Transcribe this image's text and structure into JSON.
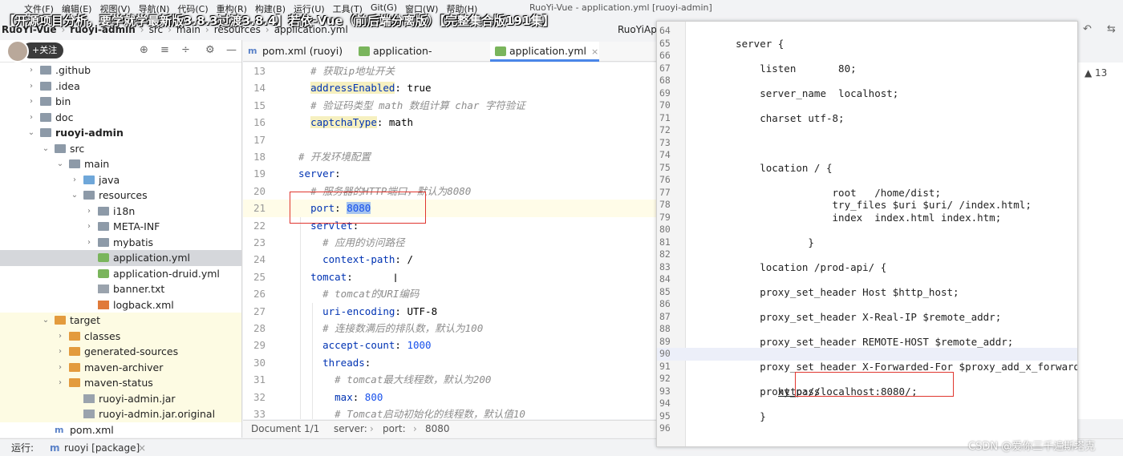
{
  "overlay_title": "【开源项目分析，要学就学最新版3.8.3过渡3.8.4】若依-Vue（前后端分离版）【完整集合版191集】",
  "menubar": {
    "items": [
      "文件(F)",
      "编辑(E)",
      "视图(V)",
      "导航(N)",
      "代码(C)",
      "重构(R)",
      "构建(B)",
      "运行(U)",
      "工具(T)",
      "Git(G)",
      "窗口(W)",
      "帮助(H)"
    ],
    "window_title": "RuoYi-Vue - application.yml [ruoyi-admin]"
  },
  "breadcrumb": {
    "items": [
      "RuoYi-Vue",
      "ruoyi-admin",
      "src",
      "main",
      "resources",
      "application.yml"
    ],
    "run_config": "RuoYiAp"
  },
  "sidebar": {
    "follow_label": "+关注",
    "tree": [
      {
        "label": ".github",
        "depth": 1,
        "arrow": "›",
        "icon": "folder"
      },
      {
        "label": ".idea",
        "depth": 1,
        "arrow": "›",
        "icon": "folder"
      },
      {
        "label": "bin",
        "depth": 1,
        "arrow": "›",
        "icon": "folder"
      },
      {
        "label": "doc",
        "depth": 1,
        "arrow": "›",
        "icon": "folder"
      },
      {
        "label": "ruoyi-admin",
        "depth": 1,
        "arrow": "⌄",
        "icon": "folder",
        "bold": true
      },
      {
        "label": "src",
        "depth": 2,
        "arrow": "⌄",
        "icon": "folder"
      },
      {
        "label": "main",
        "depth": 3,
        "arrow": "⌄",
        "icon": "folder"
      },
      {
        "label": "java",
        "depth": 4,
        "arrow": "›",
        "icon": "folder-blue"
      },
      {
        "label": "resources",
        "depth": 4,
        "arrow": "⌄",
        "icon": "folder"
      },
      {
        "label": "i18n",
        "depth": 5,
        "arrow": "›",
        "icon": "folder"
      },
      {
        "label": "META-INF",
        "depth": 5,
        "arrow": "›",
        "icon": "folder"
      },
      {
        "label": "mybatis",
        "depth": 5,
        "arrow": "›",
        "icon": "folder"
      },
      {
        "label": "application.yml",
        "depth": 5,
        "arrow": "",
        "icon": "yml",
        "selected": true
      },
      {
        "label": "application-druid.yml",
        "depth": 5,
        "arrow": "",
        "icon": "yml"
      },
      {
        "label": "banner.txt",
        "depth": 5,
        "arrow": "",
        "icon": "txt"
      },
      {
        "label": "logback.xml",
        "depth": 5,
        "arrow": "",
        "icon": "xml"
      },
      {
        "label": "target",
        "depth": 2,
        "arrow": "⌄",
        "icon": "folder-orange",
        "yellow": true
      },
      {
        "label": "classes",
        "depth": 3,
        "arrow": "›",
        "icon": "folder-orange",
        "yellow": true
      },
      {
        "label": "generated-sources",
        "depth": 3,
        "arrow": "›",
        "icon": "folder-orange",
        "yellow": true
      },
      {
        "label": "maven-archiver",
        "depth": 3,
        "arrow": "›",
        "icon": "folder-orange",
        "yellow": true
      },
      {
        "label": "maven-status",
        "depth": 3,
        "arrow": "›",
        "icon": "folder-orange",
        "yellow": true
      },
      {
        "label": "ruoyi-admin.jar",
        "depth": 4,
        "arrow": "",
        "icon": "jar",
        "yellow": true
      },
      {
        "label": "ruoyi-admin.jar.original",
        "depth": 4,
        "arrow": "",
        "icon": "jar",
        "yellow": true
      },
      {
        "label": "pom.xml",
        "depth": 2,
        "arrow": "",
        "icon": "pom"
      }
    ]
  },
  "tabs": [
    {
      "label": "pom.xml (ruoyi)",
      "active": false
    },
    {
      "label": "application-druid.yml",
      "active": false
    },
    {
      "label": "application.yml",
      "active": true
    }
  ],
  "editor": {
    "lines": [
      {
        "n": "13",
        "html": "  <span class=\"c\"># 获取ip地址开关</span>"
      },
      {
        "n": "14",
        "html": "  <span class=\"yellowkey\">addressEnabled</span>: true"
      },
      {
        "n": "15",
        "html": "  <span class=\"c\"># 验证码类型 math 数组计算 char 字符验证</span>"
      },
      {
        "n": "16",
        "html": "  <span class=\"yellowkey\">captchaType</span>: math"
      },
      {
        "n": "17",
        "html": ""
      },
      {
        "n": "18",
        "html": "<span class=\"c\"># 开发环境配置</span>"
      },
      {
        "n": "19",
        "html": "<span class=\"k\">server</span>:"
      },
      {
        "n": "20",
        "html": "  <span class=\"c\"># 服务器的HTTP端口，默认为8080</span>"
      },
      {
        "n": "21",
        "html": "  <span class=\"k\">port</span>: <span class=\"sel-text v\">8080</span>",
        "hl": true
      },
      {
        "n": "22",
        "html": "  <span class=\"k\">servlet</span>:"
      },
      {
        "n": "23",
        "html": "    <span class=\"c\"># 应用的访问路径</span>"
      },
      {
        "n": "24",
        "html": "    <span class=\"k\">context-path</span>: /"
      },
      {
        "n": "25",
        "html": "  <span class=\"k\">tomcat</span>:"
      },
      {
        "n": "26",
        "html": "    <span class=\"c\"># tomcat的URI编码</span>"
      },
      {
        "n": "27",
        "html": "    <span class=\"k\">uri-encoding</span>: UTF-8"
      },
      {
        "n": "28",
        "html": "    <span class=\"c\"># 连接数满后的排队数，默认为100</span>"
      },
      {
        "n": "29",
        "html": "    <span class=\"k\">accept-count</span>: <span class=\"v\">1000</span>"
      },
      {
        "n": "30",
        "html": "    <span class=\"k\">threads</span>:"
      },
      {
        "n": "31",
        "html": "      <span class=\"c\"># tomcat最大线程数，默认为200</span>"
      },
      {
        "n": "32",
        "html": "      <span class=\"k\">max</span>: <span class=\"v\">800</span>"
      },
      {
        "n": "33",
        "html": "      <span class=\"c\"># Tomcat启动初始化的线程数，默认值10</span>"
      }
    ]
  },
  "statusbar": {
    "doc": "Document 1/1",
    "path": [
      "server:",
      "port:",
      "8080"
    ]
  },
  "bottombar": {
    "run_label": "运行:",
    "run_target": "ruoyi [package]"
  },
  "warnings": "▲ 13",
  "nginx": {
    "lines": [
      {
        "n": "64",
        "code": ""
      },
      {
        "n": "65",
        "code": "    server {"
      },
      {
        "n": "66",
        "code": ""
      },
      {
        "n": "67",
        "code": "        listen       80;"
      },
      {
        "n": "68",
        "code": ""
      },
      {
        "n": "69",
        "code": "        server_name  localhost;"
      },
      {
        "n": "70",
        "code": ""
      },
      {
        "n": "71",
        "code": "        charset utf-8;"
      },
      {
        "n": "72",
        "code": ""
      },
      {
        "n": "73",
        "code": ""
      },
      {
        "n": "74",
        "code": ""
      },
      {
        "n": "75",
        "code": "        location / {"
      },
      {
        "n": "76",
        "code": ""
      },
      {
        "n": "77",
        "code": "                    root   /home/dist;"
      },
      {
        "n": "78",
        "code": "                    try_files $uri $uri/ /index.html;"
      },
      {
        "n": "79",
        "code": "                    index  index.html index.htm;"
      },
      {
        "n": "80",
        "code": ""
      },
      {
        "n": "81",
        "code": "                }"
      },
      {
        "n": "82",
        "code": ""
      },
      {
        "n": "83",
        "code": "        location /prod-api/ {"
      },
      {
        "n": "84",
        "code": ""
      },
      {
        "n": "85",
        "code": "        proxy_set_header Host $http_host;"
      },
      {
        "n": "86",
        "code": ""
      },
      {
        "n": "87",
        "code": "        proxy_set_header X-Real-IP $remote_addr;"
      },
      {
        "n": "88",
        "code": ""
      },
      {
        "n": "89",
        "code": "        proxy_set_header REMOTE-HOST $remote_addr;"
      },
      {
        "n": "90",
        "code": "",
        "cur": true
      },
      {
        "n": "91",
        "code": "        proxy_set_header X-Forwarded-For $proxy_add_x_forwarded"
      },
      {
        "n": "92",
        "code": ""
      },
      {
        "n": "93",
        "code": "        proxy_pass ",
        "link": "http://localhost:8080/",
        "after": ";"
      },
      {
        "n": "94",
        "code": ""
      },
      {
        "n": "95",
        "code": "        }"
      },
      {
        "n": "96",
        "code": ""
      }
    ]
  },
  "watermark": "CSDN @爱你三千遍斯塔克",
  "colors": {
    "accent": "#4a86e8",
    "annotation_red": "#e0362f",
    "selection": "#a6c4ee"
  }
}
